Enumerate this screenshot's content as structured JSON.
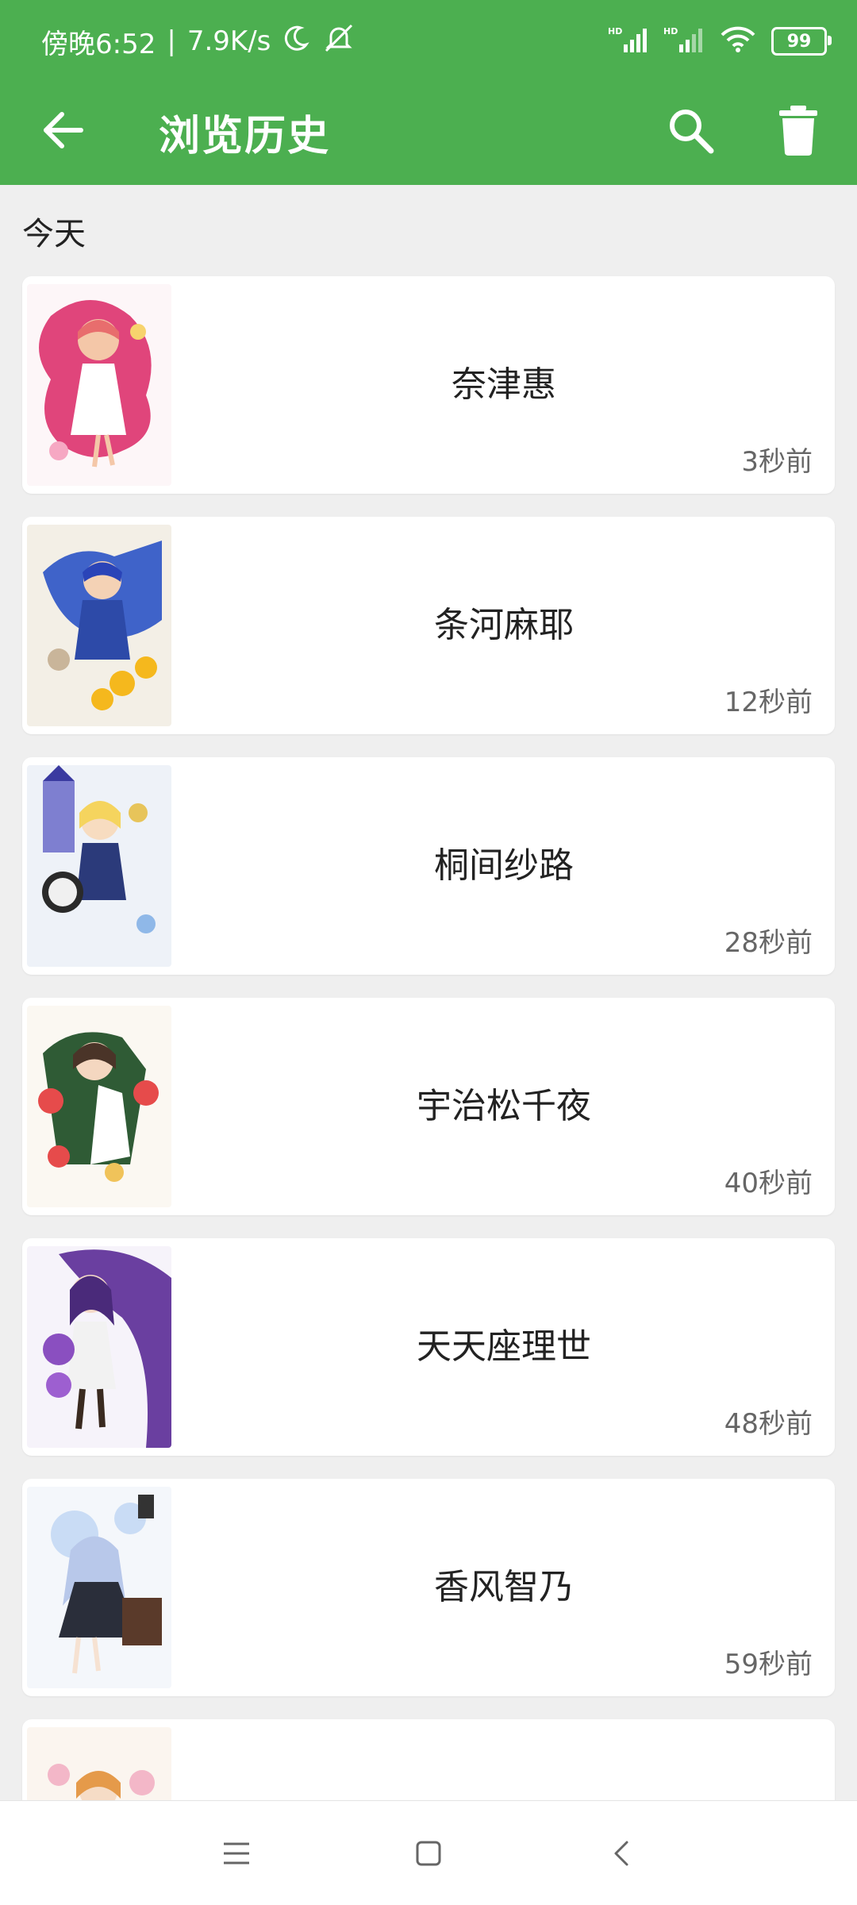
{
  "status": {
    "time": "傍晚6:52",
    "separator": "|",
    "speed": "7.9K/s",
    "battery": "99",
    "signal1_label": "HD",
    "signal2_label": "HD"
  },
  "appbar": {
    "title": "浏览历史",
    "icons": [
      "back-arrow-icon",
      "search-icon",
      "trash-icon"
    ],
    "color": "#4caf50"
  },
  "section": {
    "label": "今天"
  },
  "items": [
    {
      "name": "奈津惠",
      "time": "3秒前"
    },
    {
      "name": "条河麻耶",
      "time": "12秒前"
    },
    {
      "name": "桐间纱路",
      "time": "28秒前"
    },
    {
      "name": "宇治松千夜",
      "time": "40秒前"
    },
    {
      "name": "天天座理世",
      "time": "48秒前"
    },
    {
      "name": "香风智乃",
      "time": "59秒前"
    }
  ],
  "navbar": {
    "icons": [
      "menu-icon",
      "home-square-icon",
      "back-chevron-icon"
    ]
  }
}
